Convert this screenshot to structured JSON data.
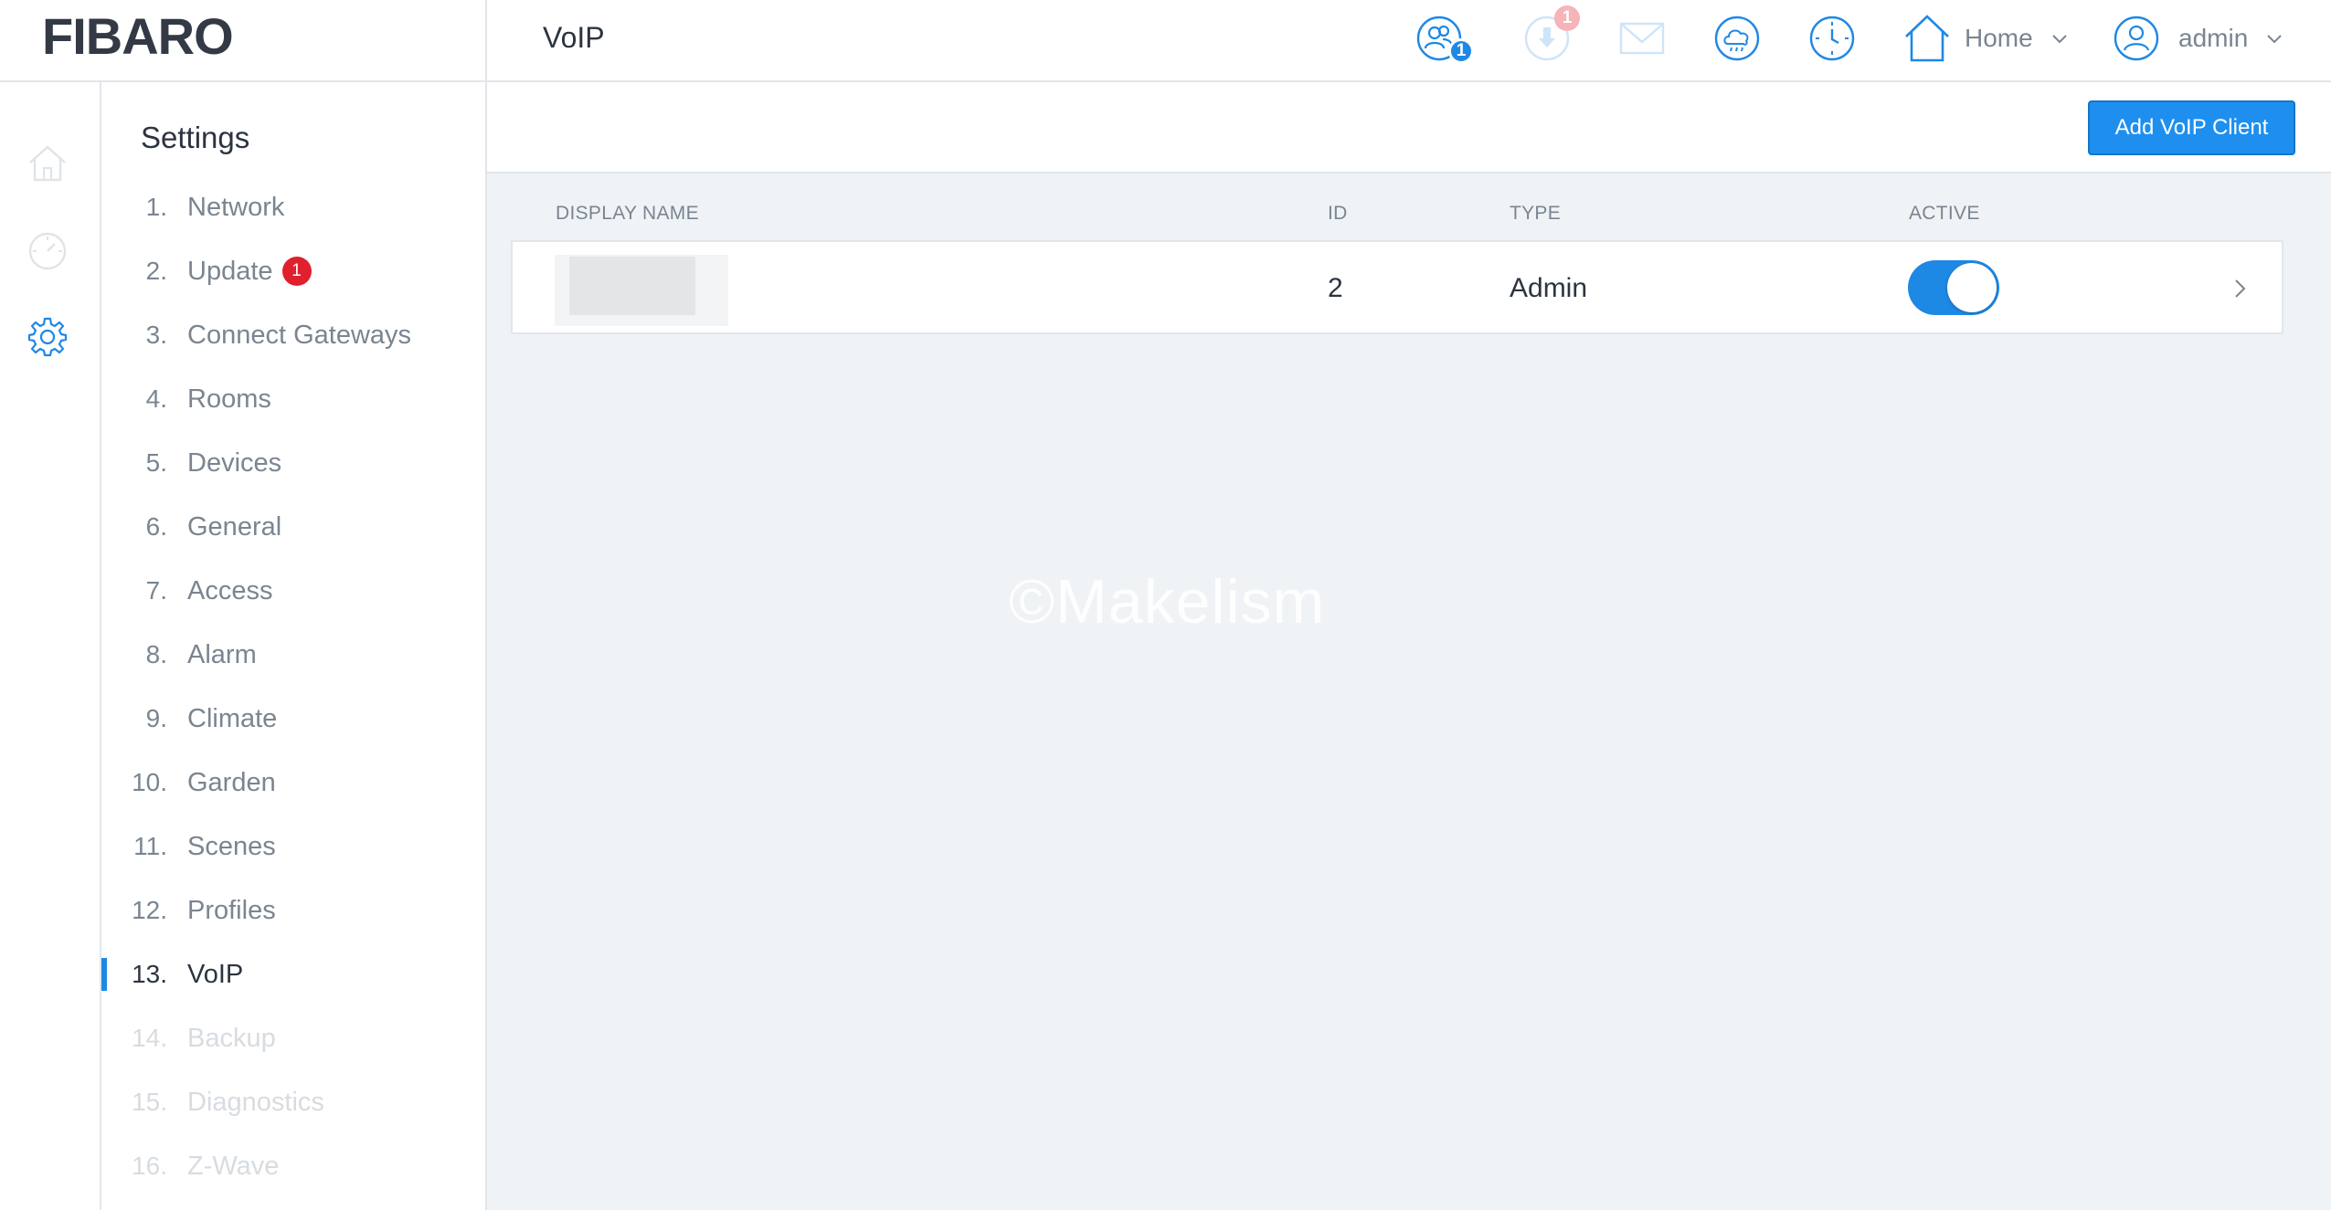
{
  "header": {
    "logo": "FIBARO",
    "page_title": "VoIP",
    "users_badge": "1",
    "updates_badge": "1",
    "home_label": "Home",
    "user_label": "admin"
  },
  "settings": {
    "title": "Settings",
    "items": [
      {
        "num": "1.",
        "label": "Network"
      },
      {
        "num": "2.",
        "label": "Update",
        "badge": "1"
      },
      {
        "num": "3.",
        "label": "Connect Gateways"
      },
      {
        "num": "4.",
        "label": "Rooms"
      },
      {
        "num": "5.",
        "label": "Devices"
      },
      {
        "num": "6.",
        "label": "General"
      },
      {
        "num": "7.",
        "label": "Access"
      },
      {
        "num": "8.",
        "label": "Alarm"
      },
      {
        "num": "9.",
        "label": "Climate"
      },
      {
        "num": "10.",
        "label": "Garden"
      },
      {
        "num": "11.",
        "label": "Scenes"
      },
      {
        "num": "12.",
        "label": "Profiles"
      },
      {
        "num": "13.",
        "label": "VoIP"
      },
      {
        "num": "14.",
        "label": "Backup"
      },
      {
        "num": "15.",
        "label": "Diagnostics"
      },
      {
        "num": "16.",
        "label": "Z-Wave"
      }
    ]
  },
  "main": {
    "add_button": "Add VoIP Client",
    "columns": {
      "display_name": "DISPLAY NAME",
      "id": "ID",
      "type": "TYPE",
      "active": "ACTIVE"
    },
    "rows": [
      {
        "id": "2",
        "type": "Admin",
        "active": true
      }
    ],
    "watermark": "©Makelism"
  },
  "colors": {
    "accent": "#1e88e5",
    "badge_red": "#e0202d",
    "content_bg": "#eff3f6",
    "text_muted": "#7a8591"
  }
}
